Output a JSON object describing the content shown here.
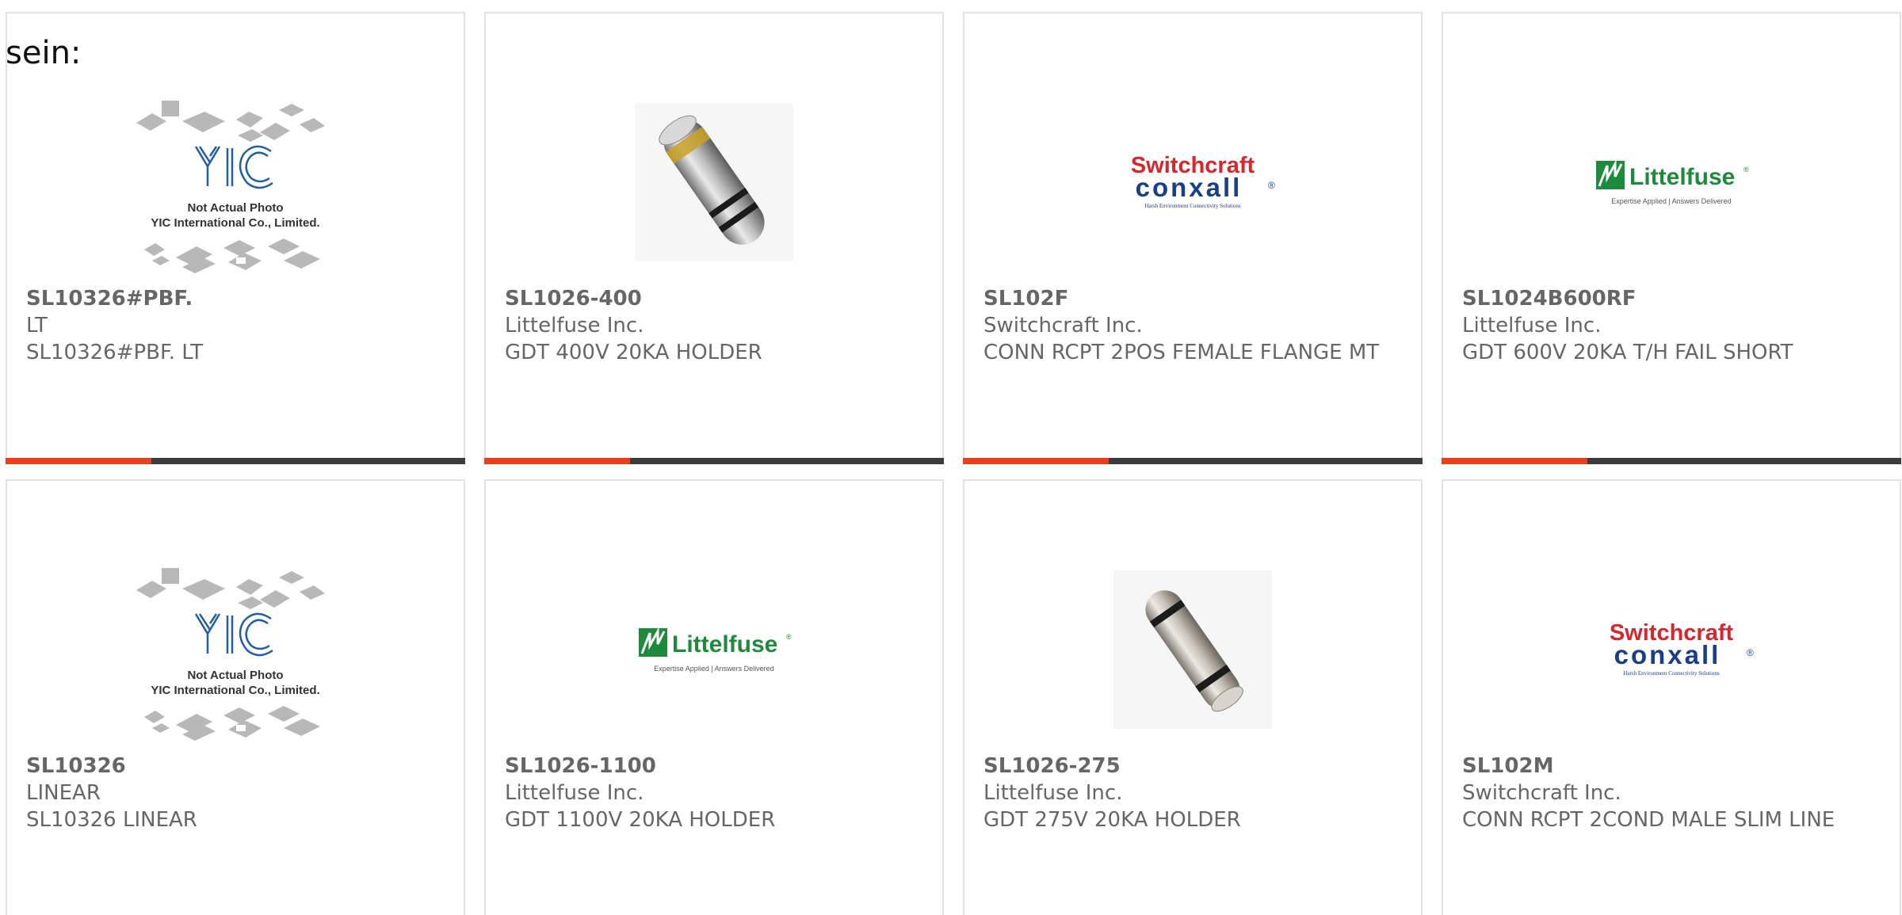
{
  "lead_text": "sein:",
  "colors": {
    "accent": "#e8401c",
    "bar": "#3c3c3c",
    "text": "#666666",
    "border": "#e2e2e2",
    "littelfuse_green": "#1e8a3c",
    "switchcraft_red": "#d8262a",
    "conxall_blue": "#1a3e8c"
  },
  "placeholder": {
    "brand": "YIC",
    "line1": "Not Actual Photo",
    "line2": "YIC International Co., Limited."
  },
  "logos": {
    "switchcraft": {
      "name": "Switchcraft",
      "sub": "conxall",
      "reg": "®",
      "tagline": "Harsh Environment Connectivity Solutions"
    },
    "littelfuse": {
      "name": "Littelfuse",
      "reg": "®",
      "tagline": "Expertise Applied | Answers Delivered"
    }
  },
  "products": [
    {
      "part_number": "SL10326#PBF.",
      "manufacturer": "LT",
      "description": "SL10326#PBF. LT",
      "image": "placeholder-icon"
    },
    {
      "part_number": "SL1026-400",
      "manufacturer": "Littelfuse Inc.",
      "description": "GDT 400V 20KA HOLDER",
      "image": "gdt-holder-photo"
    },
    {
      "part_number": "SL102F",
      "manufacturer": "Switchcraft Inc.",
      "description": "CONN RCPT 2POS FEMALE FLANGE MT",
      "image": "switchcraft-logo"
    },
    {
      "part_number": "SL1024B600RF",
      "manufacturer": "Littelfuse Inc.",
      "description": "GDT 600V 20KA T/H FAIL SHORT",
      "image": "littelfuse-logo"
    },
    {
      "part_number": "SL10326",
      "manufacturer": "LINEAR",
      "description": "SL10326 LINEAR",
      "image": "placeholder-icon"
    },
    {
      "part_number": "SL1026-1100",
      "manufacturer": "Littelfuse Inc.",
      "description": "GDT 1100V 20KA HOLDER",
      "image": "littelfuse-logo"
    },
    {
      "part_number": "SL1026-275",
      "manufacturer": "Littelfuse Inc.",
      "description": "GDT 275V 20KA HOLDER",
      "image": "gdt-holder-photo"
    },
    {
      "part_number": "SL102M",
      "manufacturer": "Switchcraft Inc.",
      "description": "CONN RCPT 2COND MALE SLIM LINE",
      "image": "switchcraft-logo"
    }
  ]
}
